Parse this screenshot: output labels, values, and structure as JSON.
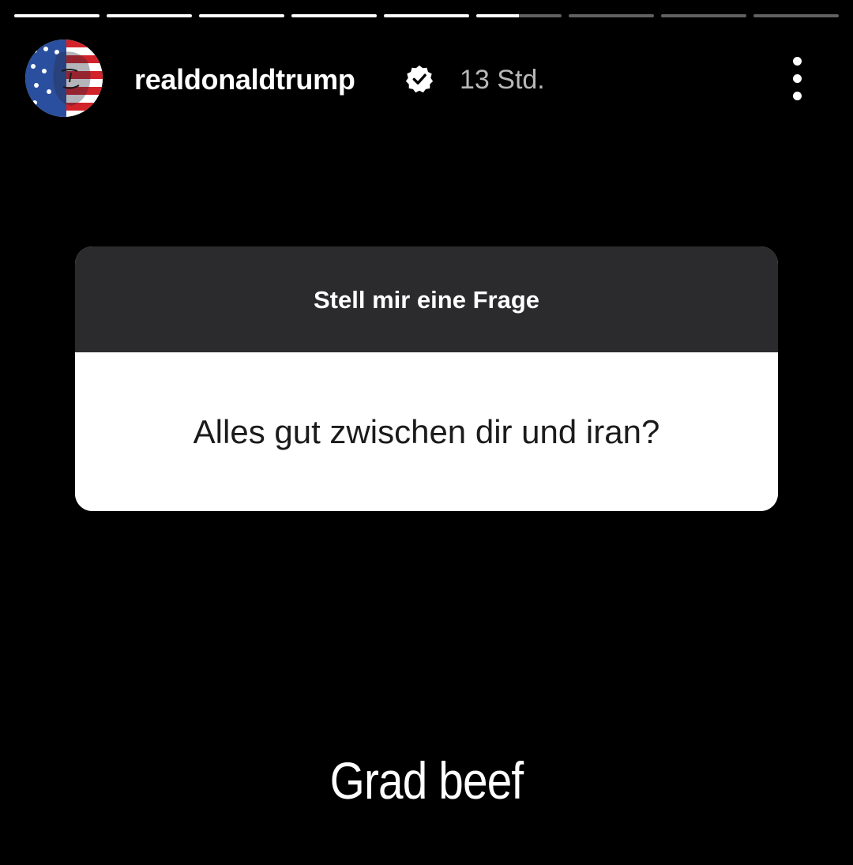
{
  "story": {
    "segments": [
      1,
      1,
      1,
      1,
      1,
      0.5,
      0,
      0,
      0
    ],
    "active_segment": 5
  },
  "header": {
    "username": "realdonaldtrump",
    "verified": true,
    "time": "13 Std.",
    "avatar_icon": "avatar-us-flag-portrait",
    "more_icon": "more-vertical-icon"
  },
  "question_sticker": {
    "title": "Stell mir eine Frage",
    "question": "Alles gut zwischen dir und iran?"
  },
  "answer": {
    "text": "Grad beef"
  },
  "colors": {
    "background": "#000000",
    "sticker_header": "#2b2b2d",
    "sticker_body": "#ffffff",
    "secondary_text": "#b8b8b8"
  }
}
